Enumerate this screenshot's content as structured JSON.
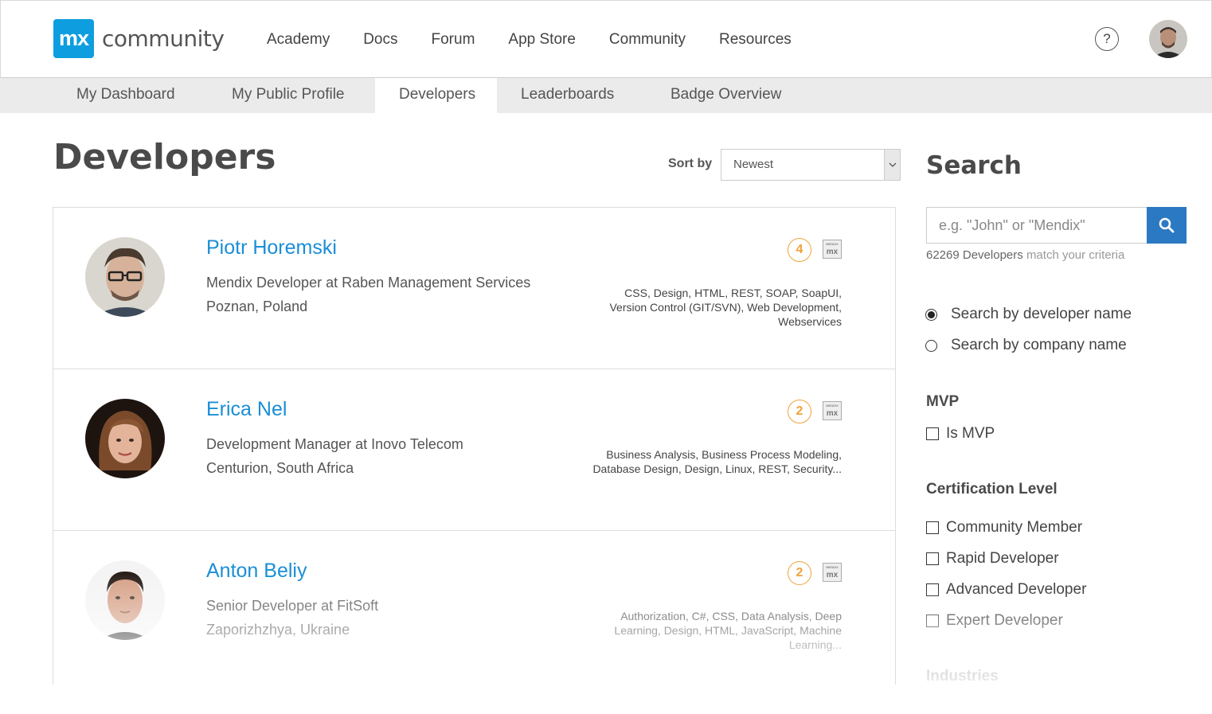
{
  "brand": {
    "logo_mark": "mx",
    "logo_text": "community"
  },
  "nav": {
    "items": [
      "Academy",
      "Docs",
      "Forum",
      "App Store",
      "Community",
      "Resources"
    ],
    "help_icon": "?"
  },
  "subtabs": [
    "My Dashboard",
    "My Public Profile",
    "Developers",
    "Leaderboards",
    "Badge Overview"
  ],
  "active_subtab": "Developers",
  "main": {
    "title": "Developers",
    "sort_label": "Sort by",
    "sort_value": "Newest"
  },
  "developers": [
    {
      "name": "Piotr Horemski",
      "role": "Mendix Developer at Raben Management Services",
      "location": "Poznan, Poland",
      "badge_count": "4",
      "skills": "CSS, Design, HTML, REST, SOAP, SoapUI, Version Control (GIT/SVN), Web Development, Webservices"
    },
    {
      "name": "Erica Nel",
      "role": "Development Manager at Inovo Telecom",
      "location": "Centurion, South Africa",
      "badge_count": "2",
      "skills": "Business Analysis, Business Process Modeling, Database Design, Design, Linux, REST, Security..."
    },
    {
      "name": "Anton Beliy",
      "role": "Senior Developer at FitSoft",
      "location": "Zaporizhzhya, Ukraine",
      "badge_count": "2",
      "skills": "Authorization, C#, CSS, Data Analysis, Deep Learning, Design, HTML, JavaScript, Machine Learning..."
    }
  ],
  "sidebar": {
    "title": "Search",
    "search_placeholder": "e.g. \"John\" or \"Mendix\"",
    "result_count": "62269 Developers",
    "result_suffix": "match your criteria",
    "search_modes": [
      "Search by developer name",
      "Search by company name"
    ],
    "mvp_heading": "MVP",
    "mvp_option": "Is MVP",
    "cert_heading": "Certification Level",
    "cert_options": [
      "Community Member",
      "Rapid Developer",
      "Advanced Developer",
      "Expert Developer"
    ],
    "industries_heading": "Industries"
  },
  "colors": {
    "brand_blue": "#0e9ee0",
    "link_blue": "#1a8ed6",
    "button_blue": "#2b79c2",
    "badge_orange": "#f0a23b"
  }
}
